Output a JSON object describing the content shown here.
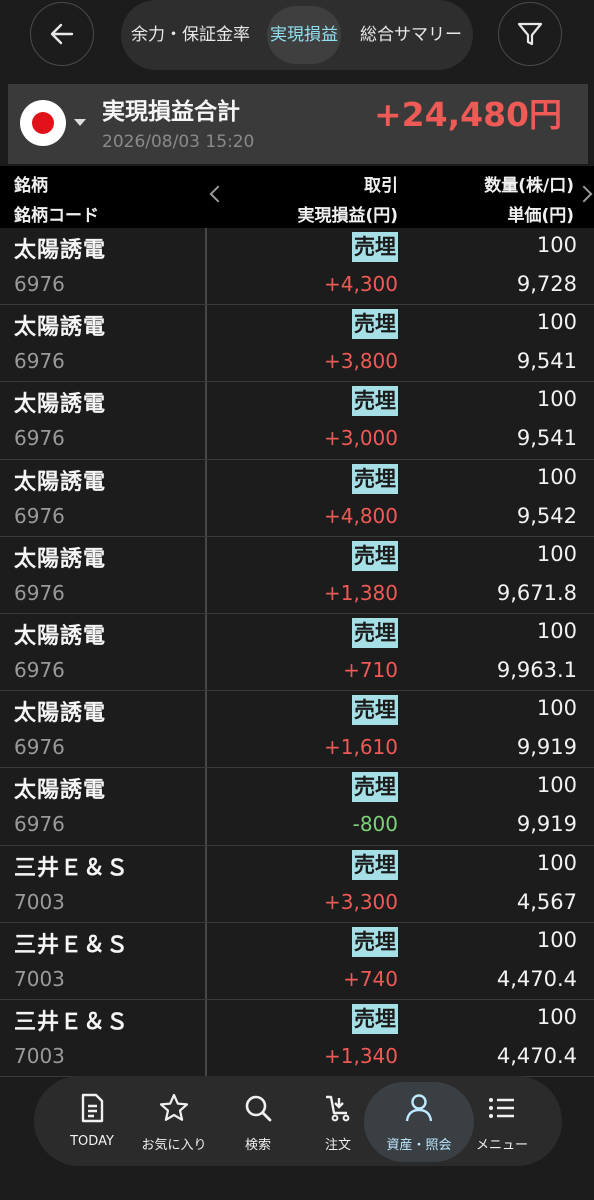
{
  "header": {
    "tabs": [
      {
        "label": "余力・保証金率",
        "active": false
      },
      {
        "label": "実現損益",
        "active": true
      },
      {
        "label": "総合サマリー",
        "active": false
      }
    ]
  },
  "summary": {
    "title": "実現損益合計",
    "date": "2026/08/03 15:20",
    "amount": "+24,480円"
  },
  "columns": {
    "name": "銘柄",
    "code": "銘柄コード",
    "trade": "取引",
    "pl": "実現損益(円)",
    "qty": "数量(株/口)",
    "price": "単価(円)"
  },
  "rows": [
    {
      "name": "太陽誘電",
      "code": "6976",
      "type": "売埋",
      "pl": "+4,300",
      "qty": "100",
      "price": "9,728"
    },
    {
      "name": "太陽誘電",
      "code": "6976",
      "type": "売埋",
      "pl": "+3,800",
      "qty": "100",
      "price": "9,541"
    },
    {
      "name": "太陽誘電",
      "code": "6976",
      "type": "売埋",
      "pl": "+3,000",
      "qty": "100",
      "price": "9,541"
    },
    {
      "name": "太陽誘電",
      "code": "6976",
      "type": "売埋",
      "pl": "+4,800",
      "qty": "100",
      "price": "9,542"
    },
    {
      "name": "太陽誘電",
      "code": "6976",
      "type": "売埋",
      "pl": "+1,380",
      "qty": "100",
      "price": "9,671.8"
    },
    {
      "name": "太陽誘電",
      "code": "6976",
      "type": "売埋",
      "pl": "+710",
      "qty": "100",
      "price": "9,963.1"
    },
    {
      "name": "太陽誘電",
      "code": "6976",
      "type": "売埋",
      "pl": "+1,610",
      "qty": "100",
      "price": "9,919"
    },
    {
      "name": "太陽誘電",
      "code": "6976",
      "type": "売埋",
      "pl": "-800",
      "qty": "100",
      "price": "9,919"
    },
    {
      "name": "三井Ｅ＆Ｓ",
      "code": "7003",
      "type": "売埋",
      "pl": "+3,300",
      "qty": "100",
      "price": "4,567"
    },
    {
      "name": "三井Ｅ＆Ｓ",
      "code": "7003",
      "type": "売埋",
      "pl": "+740",
      "qty": "100",
      "price": "4,470.4"
    },
    {
      "name": "三井Ｅ＆Ｓ",
      "code": "7003",
      "type": "売埋",
      "pl": "+1,340",
      "qty": "100",
      "price": "4,470.4"
    }
  ],
  "nav": {
    "items": [
      {
        "label": "TODAY",
        "icon": "document-icon"
      },
      {
        "label": "お気に入り",
        "icon": "star-icon"
      },
      {
        "label": "検索",
        "icon": "search-icon"
      },
      {
        "label": "注文",
        "icon": "cart-icon"
      },
      {
        "label": "資産・照会",
        "icon": "person-icon",
        "active": true
      },
      {
        "label": "メニュー",
        "icon": "menu-list-icon"
      }
    ]
  },
  "colors": {
    "positive": "#ee5a55",
    "negative": "#7dd27a",
    "trade_badge": "#a6dfe6",
    "active_tab_text": "#8fe0f0"
  }
}
